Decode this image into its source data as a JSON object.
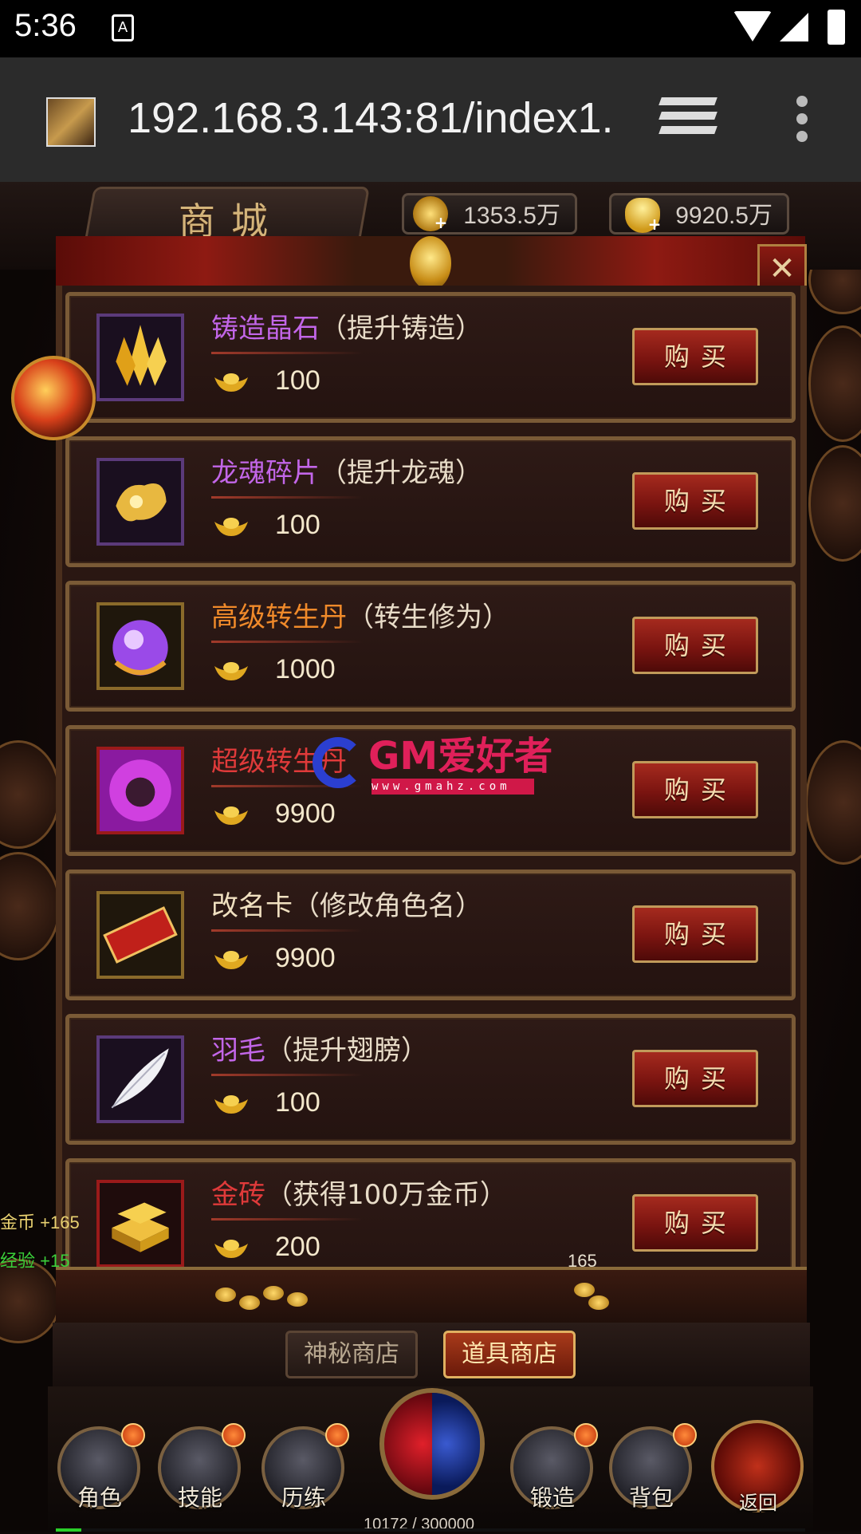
{
  "status_bar": {
    "time": "5:36",
    "notification_icon": "A"
  },
  "browser": {
    "url": "192.168.3.143:81/index1."
  },
  "shop": {
    "title": "商城",
    "currency": [
      {
        "name": "gold-coin",
        "amount": "1353.5万"
      },
      {
        "name": "yuanbao-ingot",
        "amount": "9920.5万"
      }
    ],
    "buy_label": "购买",
    "items": [
      {
        "name": "铸造晶石",
        "desc": "（提升铸造）",
        "price": "100",
        "name_color": "#c266e8",
        "frame": "purple",
        "icon": "crystal-icon"
      },
      {
        "name": "龙魂碎片",
        "desc": "（提升龙魂）",
        "price": "100",
        "name_color": "#c266e8",
        "frame": "purple",
        "icon": "dragon-soul-fragment-icon"
      },
      {
        "name": "高级转生丹",
        "desc": "（转生修为）",
        "price": "1000",
        "name_color": "#f08a2a",
        "frame": "gold",
        "icon": "rebirth-pill-icon"
      },
      {
        "name": "超级转生丹",
        "desc": "",
        "price": "9900",
        "name_color": "#e03a3a",
        "frame": "red",
        "icon": "super-rebirth-pill-icon"
      },
      {
        "name": "改名卡",
        "desc": "（修改角色名）",
        "price": "9900",
        "name_color": "#f0e0c0",
        "frame": "gold",
        "icon": "rename-card-icon"
      },
      {
        "name": "羽毛",
        "desc": "（提升翅膀）",
        "price": "100",
        "name_color": "#c266e8",
        "frame": "purple",
        "icon": "feather-icon"
      },
      {
        "name": "金砖",
        "desc": "（获得100万金币）",
        "price": "200",
        "name_color": "#e03a3a",
        "frame": "red",
        "icon": "gold-brick-icon"
      }
    ],
    "coin_count": "165",
    "tabs": [
      {
        "label": "神秘商店",
        "active": false
      },
      {
        "label": "道具商店",
        "active": true
      }
    ]
  },
  "watermark": {
    "text": "GM爱好者",
    "url": "www.gmahz.com"
  },
  "notices": [
    {
      "label": "金币",
      "value": "+165",
      "color": "#e8d070"
    },
    {
      "label": "经验",
      "value": "+15",
      "color": "#3ad03a"
    }
  ],
  "nav": [
    {
      "label": "角色",
      "icon": "helmet-icon"
    },
    {
      "label": "技能",
      "icon": "skill-book-icon"
    },
    {
      "label": "历练",
      "icon": "armor-icon"
    },
    {
      "label": "锻造",
      "icon": "anvil-icon"
    },
    {
      "label": "背包",
      "icon": "bag-icon"
    },
    {
      "label": "返回",
      "icon": "return-arrow-icon"
    }
  ],
  "exp": {
    "text": "10172 / 300000",
    "fraction": 0.0339
  }
}
